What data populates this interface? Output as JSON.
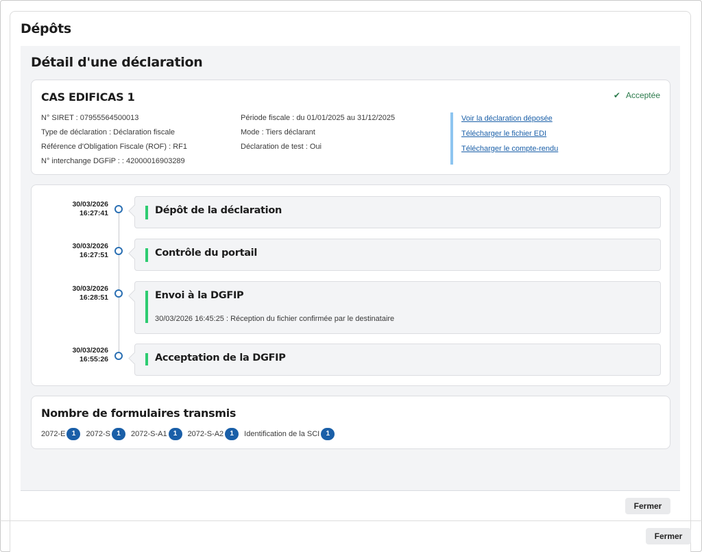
{
  "outer": {
    "title": "Dépôts",
    "close_label": "Fermer"
  },
  "modal": {
    "title": "Détail d'une déclaration",
    "close_label": "Fermer"
  },
  "declaration": {
    "name": "CAS EDIFICAS 1",
    "status": "Acceptée",
    "col1": [
      "N° SIRET : 07955564500013",
      "Type de déclaration : Déclaration fiscale",
      "Référence d'Obligation Fiscale (ROF) : RF1",
      "N° interchange DGFiP : : 42000016903289"
    ],
    "col2": [
      "Période fiscale : du 01/01/2025 au 31/12/2025",
      "Mode : Tiers déclarant",
      "Déclaration de test : Oui"
    ],
    "links": [
      "Voir la déclaration déposée",
      "Télécharger le fichier EDI",
      "Télécharger le compte-rendu"
    ]
  },
  "timeline": [
    {
      "date": "30/03/2026",
      "time": "16:27:41",
      "title": "Dépôt de la déclaration",
      "detail": ""
    },
    {
      "date": "30/03/2026",
      "time": "16:27:51",
      "title": "Contrôle du portail",
      "detail": ""
    },
    {
      "date": "30/03/2026",
      "time": "16:28:51",
      "title": "Envoi à la DGFIP",
      "detail": "30/03/2026 16:45:25 : Réception du fichier confirmée par le destinataire"
    },
    {
      "date": "30/03/2026",
      "time": "16:55:26",
      "title": "Acceptation de la DGFIP",
      "detail": ""
    }
  ],
  "forms": {
    "title": "Nombre de formulaires transmis",
    "items": [
      {
        "label": "2072-E",
        "count": "1"
      },
      {
        "label": "2072-S",
        "count": "1"
      },
      {
        "label": "2072-S-A1",
        "count": "1"
      },
      {
        "label": "2072-S-A2",
        "count": "1"
      },
      {
        "label": "Identification de la SCI",
        "count": "1"
      }
    ]
  },
  "colors": {
    "accent": "#1a5fa8",
    "success": "#2ecc71",
    "status_text": "#2b7a4b",
    "link_border": "#8ec5f0"
  }
}
